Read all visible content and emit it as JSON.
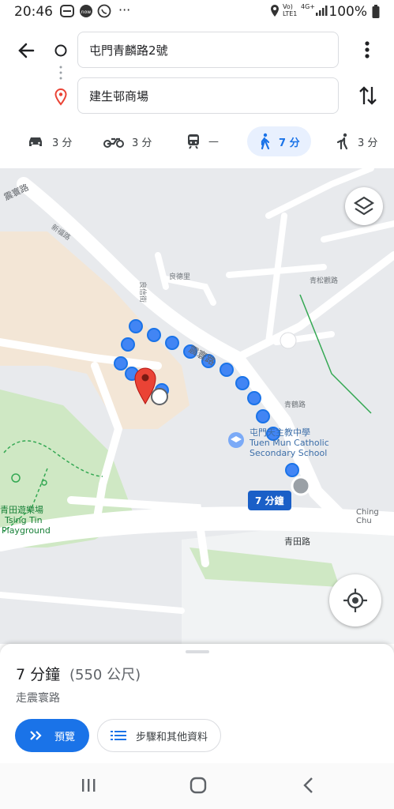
{
  "status_bar": {
    "time": "20:46",
    "app_icons": [
      "now-icon",
      "whatsapp-icon"
    ],
    "more": "···",
    "network": "Vo) LTE1",
    "net2": "4G+",
    "battery": "100%"
  },
  "directions": {
    "origin": "屯門青麟路2號",
    "destination": "建生邨商場"
  },
  "modes": [
    {
      "id": "car",
      "icon": "car-icon",
      "value": "3 分"
    },
    {
      "id": "motorbike",
      "icon": "motorbike-icon",
      "value": "3 分"
    },
    {
      "id": "transit",
      "icon": "train-icon",
      "value": "—"
    },
    {
      "id": "walk",
      "icon": "walk-icon",
      "value": "7 分",
      "active": true
    },
    {
      "id": "ride",
      "icon": "ride-icon",
      "value": "3 分"
    }
  ],
  "map": {
    "labels": {
      "road1": "震寰路",
      "road2": "新福路",
      "road3": "良德里",
      "road4": "良信街",
      "road5": "青松觀路",
      "road6": "青鶴路",
      "road7": "震寰路",
      "road8": "青田路",
      "road9": "Ching Chu",
      "school_zh": "屯門天主教中學",
      "school_en1": "Tuen Mun Catholic",
      "school_en2": "Secondary School",
      "park_zh": "青田遊樂場",
      "park_en1": "Tsing Tin",
      "park_en2": "Playground",
      "route_badge": "7 分鐘"
    },
    "colors": {
      "route": "#1a73e8",
      "pin": "#ea4335",
      "park": "#cfe8c4",
      "building": "#f3e6d6"
    }
  },
  "sheet": {
    "duration": "7 分鐘",
    "distance": "(550 公尺)",
    "via": "走震寰路",
    "preview_label": "預覽",
    "steps_label": "步驟和其他資料"
  }
}
